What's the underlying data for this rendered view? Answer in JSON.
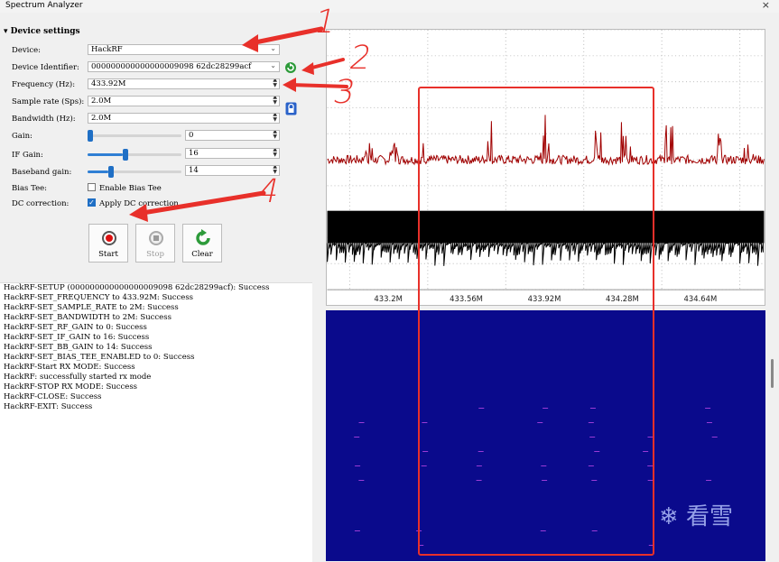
{
  "window": {
    "title": "Spectrum Analyzer",
    "close_glyph": "×"
  },
  "settings": {
    "section_title": "Device settings",
    "device_label": "Device:",
    "device_value": "HackRF",
    "identifier_label": "Device Identifier:",
    "identifier_value": "000000000000000009098 62dc28299acf",
    "frequency_label": "Frequency (Hz):",
    "frequency_value": "433.92M",
    "sample_rate_label": "Sample rate (Sps):",
    "sample_rate_value": "2.0M",
    "bandwidth_label": "Bandwidth (Hz):",
    "bandwidth_value": "2.0M",
    "gain_label": "Gain:",
    "gain_value": "0",
    "gain_level": 0.0,
    "if_gain_label": "IF Gain:",
    "if_gain_value": "16",
    "if_gain_level": 0.4,
    "bb_gain_label": "Baseband gain:",
    "bb_gain_value": "14",
    "bb_gain_level": 0.23,
    "bias_tee_label": "Bias Tee:",
    "bias_tee_check_label": "Enable Bias Tee",
    "dc_label": "DC correction:",
    "dc_check_label": "Apply DC correction"
  },
  "buttons": {
    "start": "Start",
    "stop": "Stop",
    "clear": "Clear"
  },
  "log": [
    "HackRF-SETUP (000000000000000009098 62dc28299acf): Success",
    "HackRF-SET_FREQUENCY to 433.92M: Success",
    "HackRF-SET_SAMPLE_RATE to 2M: Success",
    "HackRF-SET_BANDWIDTH to 2M: Success",
    "HackRF-SET_RF_GAIN to 0: Success",
    "HackRF-SET_IF_GAIN to 16: Success",
    "HackRF-SET_BB_GAIN to 14: Success",
    "HackRF-SET_BIAS_TEE_ENABLED to 0: Success",
    "HackRF-Start RX MODE: Success",
    "HackRF: successfully started rx mode",
    "HackRF-STOP RX MODE: Success",
    "HackRF-CLOSE: Success",
    "HackRF-EXIT: Success"
  ],
  "spectrum": {
    "tick_labels": [
      "433.2M",
      "433.56M",
      "433.92M",
      "434.28M",
      "434.64M"
    ],
    "trace_color": "#a00000",
    "wave_color": "#000000"
  },
  "annotations": [
    "1",
    "2",
    "3",
    "4"
  ],
  "watermark": "❄ 看雪",
  "colors": {
    "annotation": "#e8302a",
    "waterfall_bg": "#0a0a8c",
    "accent": "#1f6fc5"
  }
}
